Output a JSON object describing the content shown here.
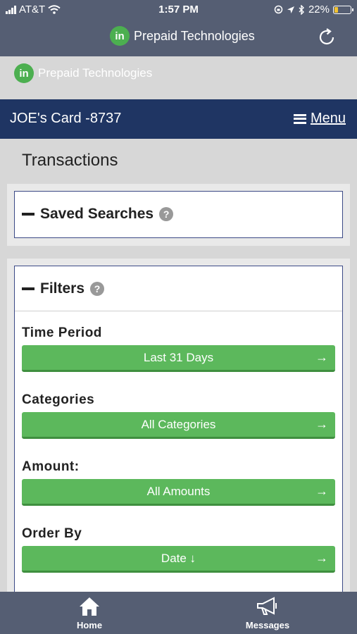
{
  "status_bar": {
    "carrier": "AT&T",
    "time": "1:57 PM",
    "battery": "22%",
    "battery_level": 0.22
  },
  "app_header": {
    "logo_letter": "in",
    "brand": "Prepaid Technologies",
    "refresh_icon": "refresh-icon"
  },
  "brand_strip": {
    "logo_letter": "in",
    "brand": "Prepaid Technologies"
  },
  "card_bar": {
    "card_name": "JOE's Card -8737",
    "menu_label": "Menu"
  },
  "page": {
    "title": "Transactions"
  },
  "saved_searches": {
    "title": "Saved Searches",
    "help": "?"
  },
  "filters": {
    "title": "Filters",
    "help": "?",
    "items": [
      {
        "label": "Time Period",
        "value": "Last 31 Days"
      },
      {
        "label": "Categories",
        "value": "All Categories"
      },
      {
        "label": "Amount:",
        "value": "All Amounts"
      },
      {
        "label": "Order By",
        "value": "Date ↓"
      }
    ]
  },
  "tabbar": {
    "home": "Home",
    "messages": "Messages"
  },
  "colors": {
    "header": "#555e73",
    "card_bar": "#1f3563",
    "button_green": "#5cb85c",
    "logo_green": "#4caf50"
  }
}
